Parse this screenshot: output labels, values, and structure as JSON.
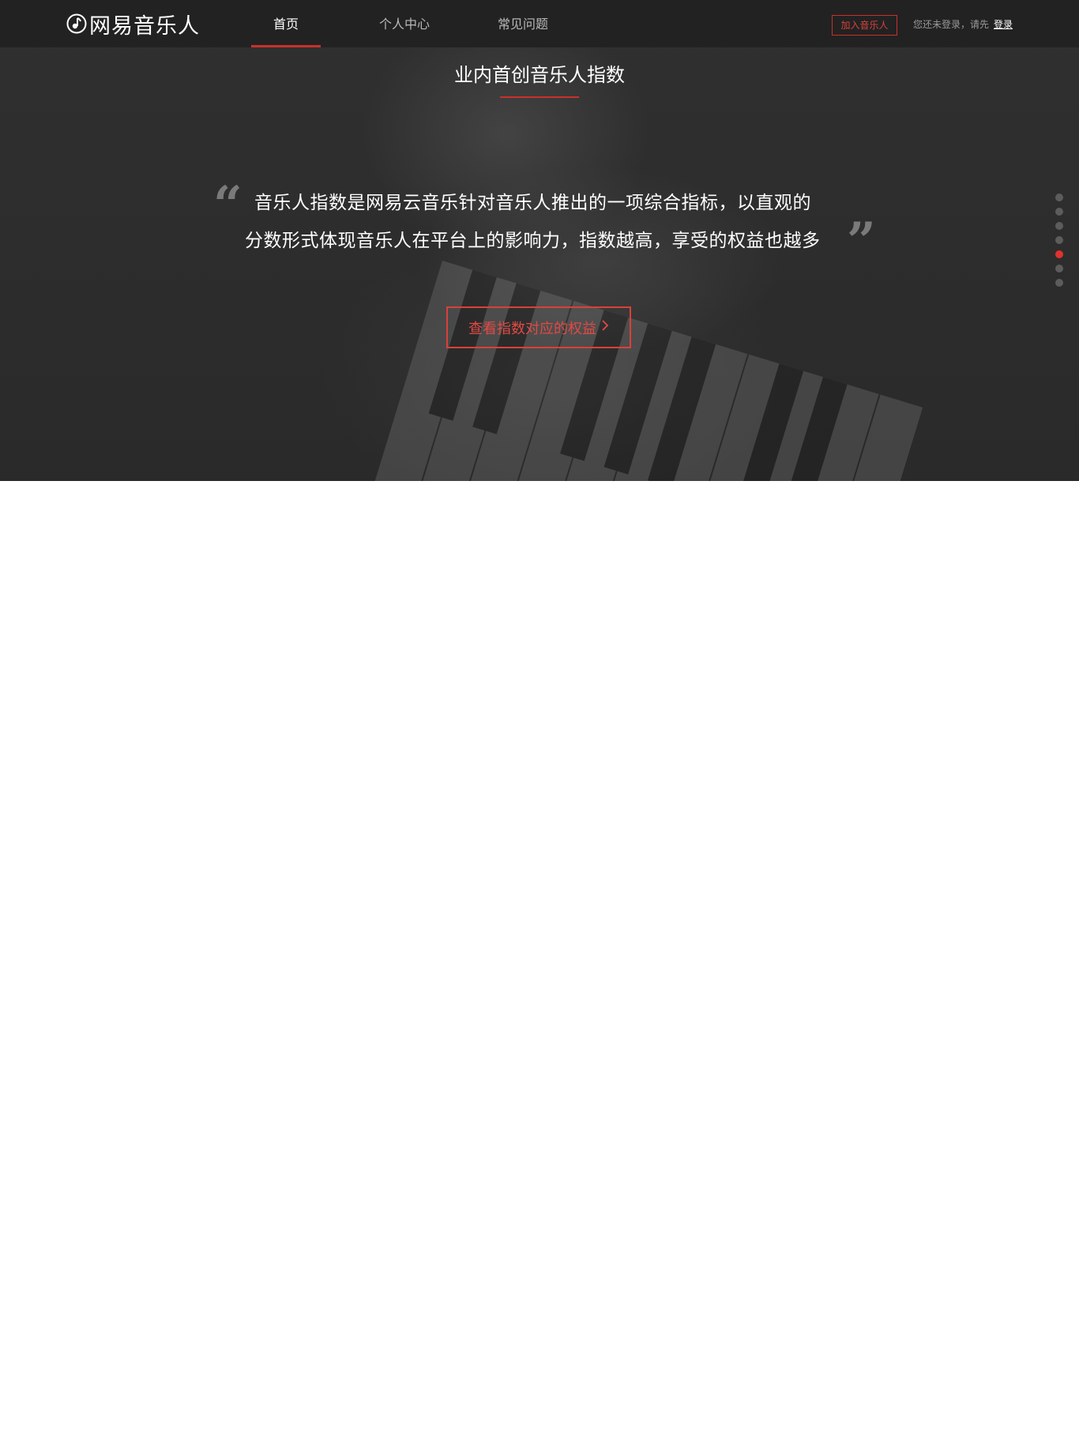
{
  "brand": {
    "logo_text": "网易音乐人",
    "accent_color": "#c9302c"
  },
  "nav": {
    "items": [
      {
        "label": "首页",
        "active": true
      },
      {
        "label": "个人中心",
        "active": false
      },
      {
        "label": "常见问题",
        "active": false
      }
    ]
  },
  "header": {
    "join_button": "加入音乐人",
    "login_hint": "您还未登录，请先",
    "login_link": "登录"
  },
  "hero": {
    "title": "业内首创音乐人指数",
    "quote_open": "“",
    "quote_close": "”",
    "quote_line_1": "音乐人指数是网易云音乐针对音乐人推出的一项综合指标，以直观的",
    "quote_line_2": "分数形式体现音乐人在平台上的影响力，指数越高，享受的权益也越多",
    "cta_label": "查看指数对应的权益",
    "cta_icon": "chevron-right-icon"
  },
  "pager": {
    "total": 7,
    "active_index": 4
  }
}
